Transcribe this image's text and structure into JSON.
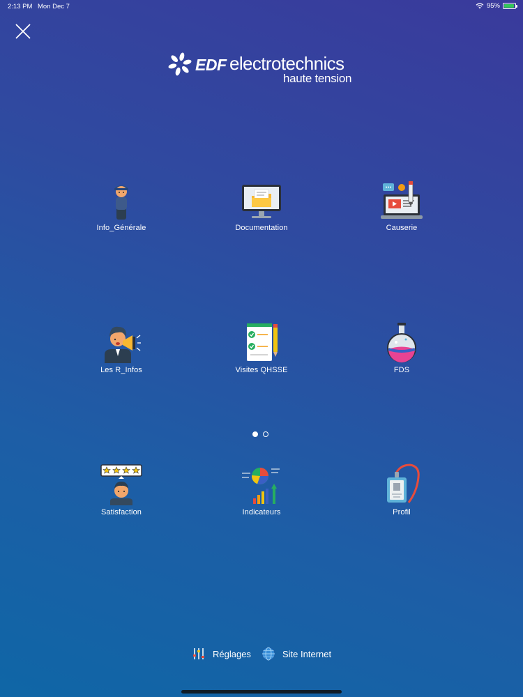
{
  "status_bar": {
    "time": "2:13 PM",
    "date": "Mon Dec 7",
    "battery": "95%"
  },
  "logo": {
    "brand": "EDF",
    "name": "electrotechnics",
    "tagline": "haute tension"
  },
  "grid": [
    {
      "label": "Info_Générale",
      "icon": "user-person-icon"
    },
    {
      "label": "Documentation",
      "icon": "computer-folder-icon"
    },
    {
      "label": "Causerie",
      "icon": "laptop-video-icon"
    },
    {
      "label": "Les R_Infos",
      "icon": "megaphone-person-icon"
    },
    {
      "label": "Visites QHSSE",
      "icon": "checklist-icon"
    },
    {
      "label": "FDS",
      "icon": "flask-icon"
    },
    {
      "label": "Satisfaction",
      "icon": "rating-stars-icon"
    },
    {
      "label": "Indicateurs",
      "icon": "chart-growth-icon"
    },
    {
      "label": "Profil",
      "icon": "badge-lanyard-icon"
    }
  ],
  "pagination": {
    "current": 1,
    "total": 2
  },
  "footer": {
    "settings_label": "Réglages",
    "website_label": "Site Internet"
  },
  "colors": {
    "background_top": "#3a3a9c",
    "background_bottom": "#0f66a6",
    "battery": "#34c759"
  }
}
